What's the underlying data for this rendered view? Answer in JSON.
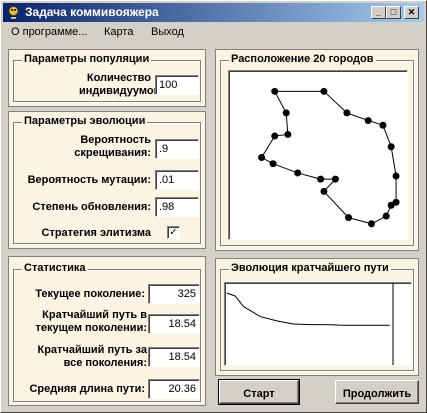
{
  "window": {
    "title": "Задача коммивояжера"
  },
  "menu": [
    {
      "label": "О программе..."
    },
    {
      "label": "Карта"
    },
    {
      "label": "Выход"
    }
  ],
  "population": {
    "title": "Параметры популяции",
    "count_label": "Количество индивидуумов:",
    "count_value": "100"
  },
  "evolution": {
    "title": "Параметры эволюции",
    "crossover_label": "Вероятность скрещивания:",
    "crossover_value": ".9",
    "mutation_label": "Вероятность мутации:",
    "mutation_value": ".01",
    "update_label": "Степень обновления:",
    "update_value": ".98",
    "elitism_label": "Стратегия элитизма",
    "elitism_checked": true
  },
  "stats": {
    "title": "Статистика",
    "generation_label": "Текущее поколение:",
    "generation_value": "325",
    "shortest_current_label": "Кратчайший путь в текущем поколении:",
    "shortest_current_value": "18.54",
    "shortest_all_label": "Кратчайший путь за все поколения:",
    "shortest_all_value": "18.54",
    "avg_label": "Средняя длина пути:",
    "avg_value": "20.36"
  },
  "map_panel": {
    "title": "Расположение 20 городов"
  },
  "evolution_panel": {
    "title": "Эволюция кратчайшего пути"
  },
  "buttons": {
    "start": "Старт",
    "continue": "Продолжить"
  },
  "colors": {
    "title_start": "#0a246a",
    "title_end": "#a6caf0",
    "panel_bg": "#fbf4e3",
    "face": "#d4d0c8"
  },
  "chart_data": [
    {
      "type": "scatter",
      "connected": "closed-tour",
      "x": [
        0.23,
        0.53,
        0.67,
        0.8,
        0.89,
        0.94,
        0.97,
        0.97,
        0.94,
        0.91,
        0.82,
        0.68,
        0.53,
        0.6,
        0.51,
        0.37,
        0.22,
        0.15,
        0.23,
        0.31,
        0.3
      ],
      "y": [
        0.08,
        0.08,
        0.22,
        0.27,
        0.3,
        0.44,
        0.63,
        0.8,
        0.82,
        0.89,
        0.94,
        0.9,
        0.73,
        0.65,
        0.65,
        0.61,
        0.55,
        0.51,
        0.37,
        0.36,
        0.22
      ],
      "xlim": [
        0,
        1
      ],
      "ylim": [
        0,
        1
      ],
      "grid": false
    },
    {
      "type": "line",
      "x": [
        0,
        0.05,
        0.1,
        0.15,
        0.2,
        0.3,
        0.4,
        0.5,
        0.6,
        0.7,
        0.8,
        0.9,
        0.98
      ],
      "y": [
        1.0,
        0.95,
        0.78,
        0.7,
        0.62,
        0.55,
        0.5,
        0.49,
        0.49,
        0.48,
        0.48,
        0.48,
        0.48
      ],
      "xlim": [
        0,
        1
      ],
      "ylim": [
        0,
        1
      ],
      "grid": false
    }
  ]
}
